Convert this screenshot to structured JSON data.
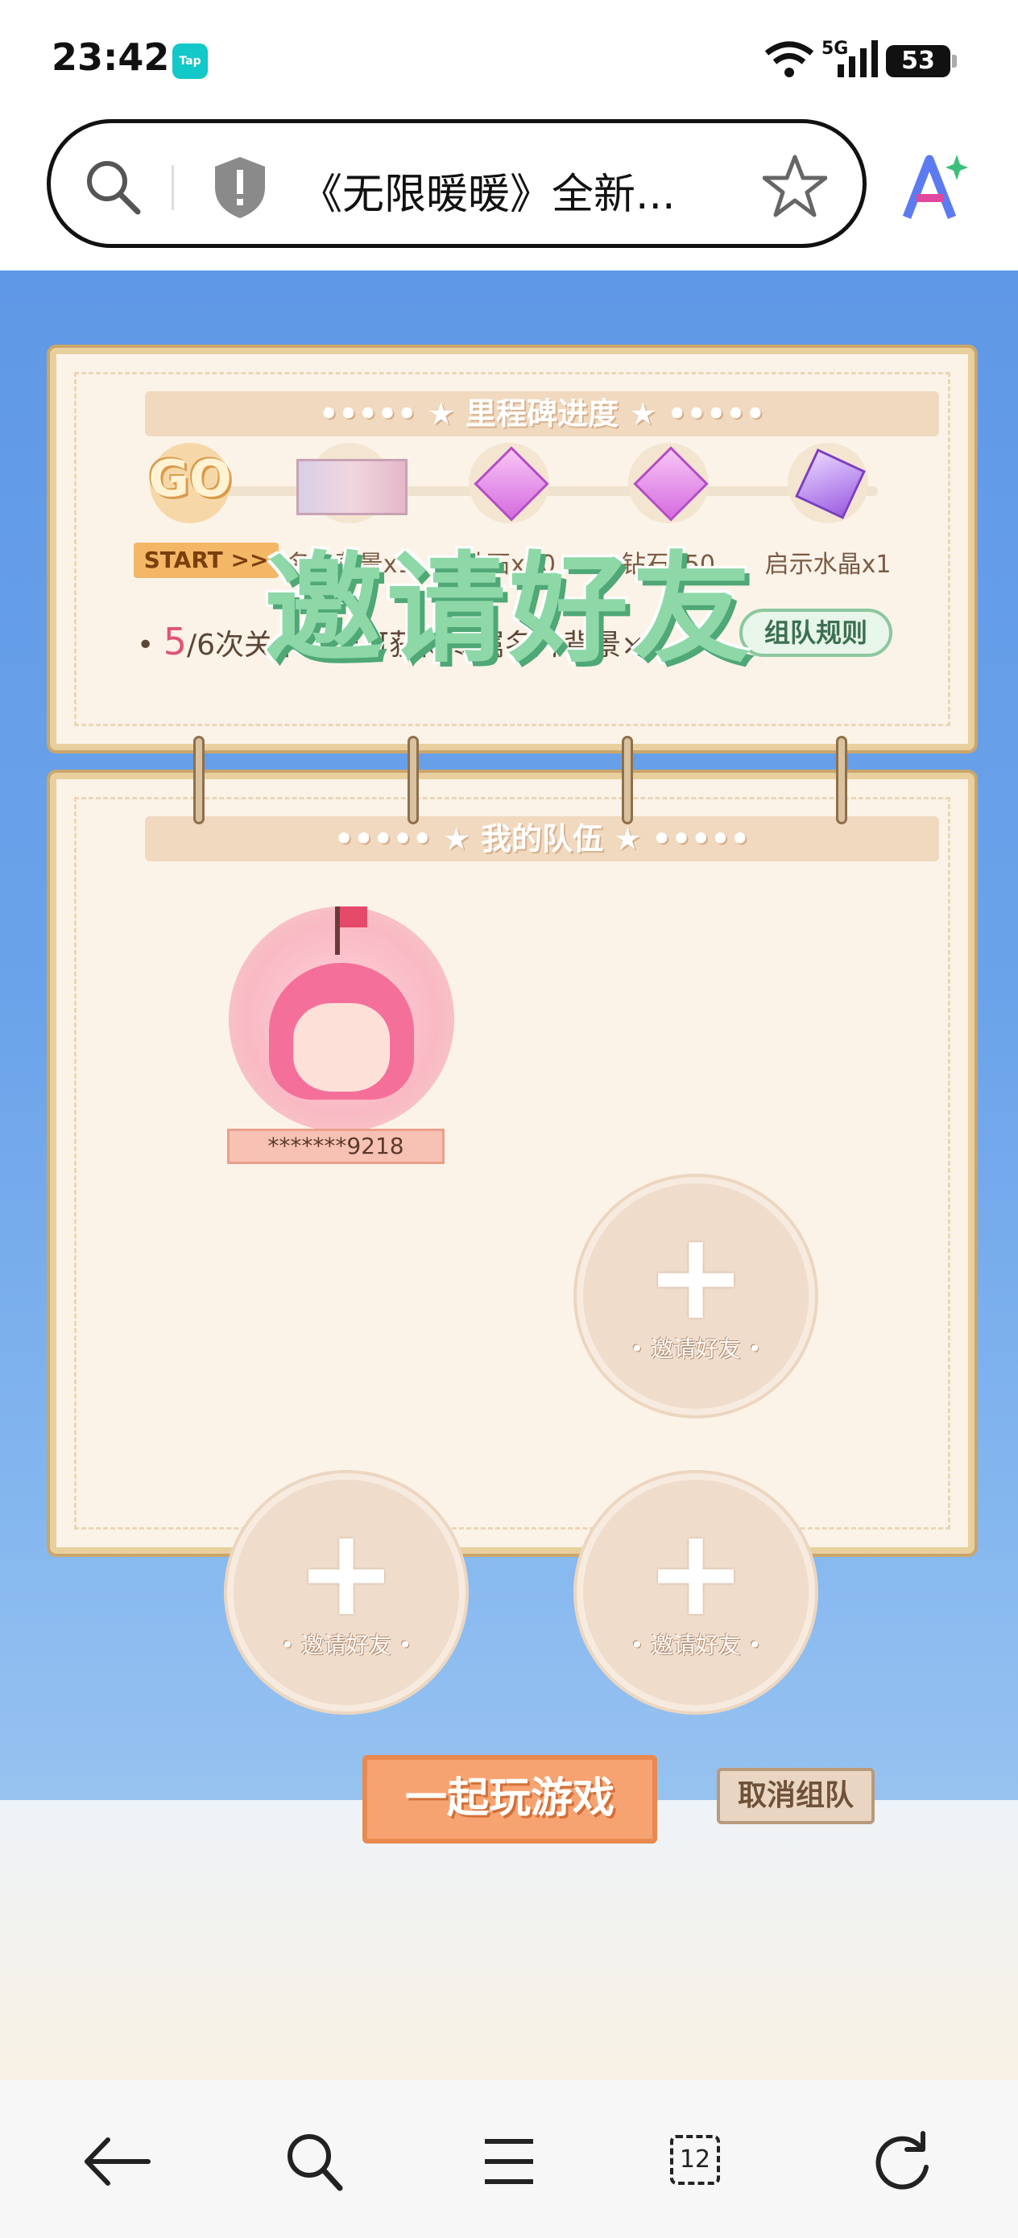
{
  "status_bar": {
    "time": "23:42",
    "app_badge": "Tap",
    "network": "5G",
    "battery": "53"
  },
  "browser": {
    "page_title": "《无限暖暖》全新...",
    "tab_count": "12"
  },
  "game": {
    "headline": "邀请好友",
    "milestone": {
      "banner": "••••• ★ 里程碑进度 ★ •••••",
      "start_icon": "GO",
      "start_label": "START >>",
      "rewards": [
        "名片背景x1",
        "钻石x30",
        "钻石x50",
        "启示水晶x1"
      ],
      "progress_current": "5",
      "progress_text": "/6次关卡首通可获得专属名片背景×1",
      "rules_button": "组队规则"
    },
    "team": {
      "banner": "••••• ★ 我的队伍 ★ •••••",
      "member_name": "*******9218",
      "invite_label": "• 邀请好友 •"
    },
    "play_button": "一起玩游戏",
    "cancel_button": "取消组队"
  }
}
